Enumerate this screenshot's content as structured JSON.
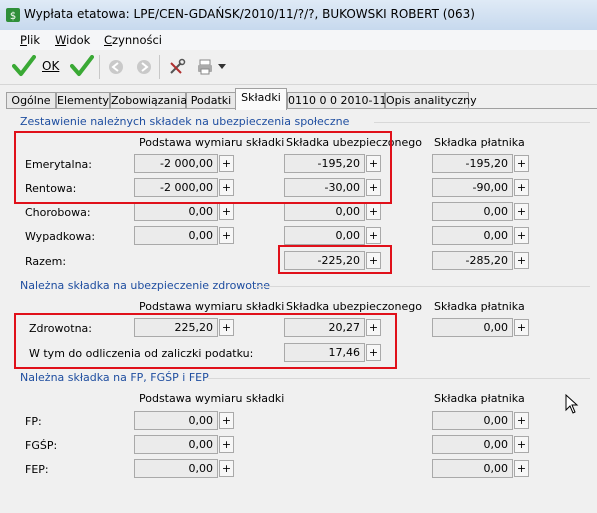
{
  "window": {
    "title": "Wypłata etatowa: LPE/CEN-GDAŃSK/2010/11/?/?, BUKOWSKI ROBERT (063)"
  },
  "menu": {
    "items": [
      {
        "label": "Plik",
        "key": "P",
        "rest": "lik"
      },
      {
        "label": "Widok",
        "key": "W",
        "rest": "idok"
      },
      {
        "label": "Czynności",
        "key": "C",
        "rest": "zynności"
      }
    ]
  },
  "toolbar": {
    "ok_label": "OK"
  },
  "tabs": [
    "Ogólne",
    "Elementy",
    "Zobowiązania",
    "Podatki",
    "Składki",
    "0110 0 0 2010-11",
    "Opis analityczny"
  ],
  "active_tab": "Składki",
  "social": {
    "title": "Zestawienie należnych składek na ubezpieczenia społeczne",
    "headers": {
      "base": "Podstawa wymiaru składki",
      "insured": "Składka ubezpieczonego",
      "payer": "Składka płatnika"
    },
    "rows": {
      "emerytalna": {
        "label": "Emerytalna:",
        "base": "-2 000,00",
        "insured": "-195,20",
        "payer": "-195,20"
      },
      "rentowa": {
        "label": "Rentowa:",
        "base": "-2 000,00",
        "insured": "-30,00",
        "payer": "-90,00"
      },
      "chorobowa": {
        "label": "Chorobowa:",
        "base": "0,00",
        "insured": "0,00",
        "payer": "0,00"
      },
      "wypadkowa": {
        "label": "Wypadkowa:",
        "base": "0,00",
        "insured": "0,00",
        "payer": "0,00"
      },
      "razem": {
        "label": "Razem:",
        "insured": "-225,20",
        "payer": "-285,20"
      }
    }
  },
  "health": {
    "title": "Należna składka na ubezpieczenie zdrowotne",
    "headers": {
      "base": "Podstawa wymiaru składki",
      "insured": "Składka ubezpieczonego",
      "payer": "Składka płatnika"
    },
    "zdrowotna": {
      "label": "Zdrowotna:",
      "base": "225,20",
      "insured": "20,27",
      "payer": "0,00"
    },
    "odliczenia": {
      "label": "W tym do odliczenia od zaliczki podatku:",
      "insured": "17,46"
    }
  },
  "funds": {
    "title": "Należna składka na FP, FGŚP i FEP",
    "headers": {
      "base": "Podstawa wymiaru składki",
      "payer": "Składka płatnika"
    },
    "rows": {
      "fp": {
        "label": "FP:",
        "base": "0,00",
        "payer": "0,00"
      },
      "fgsp": {
        "label": "FGŚP:",
        "base": "0,00",
        "payer": "0,00"
      },
      "fep": {
        "label": "FEP:",
        "base": "0,00",
        "payer": "0,00"
      }
    }
  },
  "plus_glyph": "+",
  "colors": {
    "highlight": "#e0101a",
    "section_title": "#1f4ea0",
    "ok_green": "#3aa935"
  }
}
